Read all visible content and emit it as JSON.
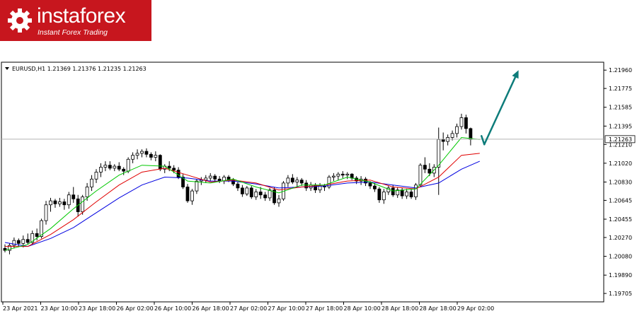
{
  "logo": {
    "brand": "instaforex",
    "tagline": "Instant Forex Trading",
    "icon": "gear-icon",
    "bg_color": "#c7161e"
  },
  "chart_data": {
    "type": "candlestick",
    "symbol_header": "EURUSD,H1  1.21369 1.21376 1.21235 1.21263",
    "current_price_label": "1.21263",
    "current_price": 1.21263,
    "ylim": [
      1.1962,
      1.2204
    ],
    "y_ticks": [
      "1.21960",
      "1.21775",
      "1.21585",
      "1.21395",
      "1.21210",
      "1.21020",
      "1.20830",
      "1.20645",
      "1.20455",
      "1.20270",
      "1.20080",
      "1.19890",
      "1.19705"
    ],
    "x_ticks": [
      "23 Apr 2021",
      "23 Apr 10:00",
      "23 Apr 18:00",
      "26 Apr 02:00",
      "26 Apr 10:00",
      "26 Apr 18:00",
      "27 Apr 02:00",
      "27 Apr 10:00",
      "27 Apr 18:00",
      "28 Apr 10:00",
      "28 Apr 18:00",
      "28 Apr 18:00",
      "29 Apr 02:00"
    ],
    "ohlc": [
      [
        1.2016,
        1.202,
        1.2012,
        1.2014
      ],
      [
        1.2014,
        1.2021,
        1.201,
        1.2019
      ],
      [
        1.2019,
        1.2027,
        1.2016,
        1.2024
      ],
      [
        1.2024,
        1.2026,
        1.2018,
        1.2021
      ],
      [
        1.2021,
        1.2029,
        1.2017,
        1.2025
      ],
      [
        1.2025,
        1.2031,
        1.202,
        1.2022
      ],
      [
        1.2022,
        1.2034,
        1.202,
        1.2031
      ],
      [
        1.2031,
        1.2036,
        1.2024,
        1.2028
      ],
      [
        1.2028,
        1.2046,
        1.2026,
        1.2044
      ],
      [
        1.2044,
        1.2064,
        1.204,
        1.206
      ],
      [
        1.206,
        1.2067,
        1.2053,
        1.2064
      ],
      [
        1.2064,
        1.2066,
        1.2057,
        1.2061
      ],
      [
        1.2061,
        1.2067,
        1.2058,
        1.2063
      ],
      [
        1.2063,
        1.2066,
        1.2055,
        1.206
      ],
      [
        1.206,
        1.2073,
        1.2056,
        1.207
      ],
      [
        1.207,
        1.2078,
        1.2062,
        1.2066
      ],
      [
        1.2066,
        1.207,
        1.2048,
        1.2053
      ],
      [
        1.2053,
        1.207,
        1.205,
        1.2068
      ],
      [
        1.2068,
        1.2082,
        1.2064,
        1.2078
      ],
      [
        1.2078,
        1.209,
        1.2074,
        1.2086
      ],
      [
        1.2086,
        1.2096,
        1.2082,
        1.2093
      ],
      [
        1.2093,
        1.2102,
        1.2088,
        1.2098
      ],
      [
        1.2098,
        1.2104,
        1.2094,
        1.21
      ],
      [
        1.21,
        1.2104,
        1.2095,
        1.2097
      ],
      [
        1.2097,
        1.2101,
        1.2094,
        1.2099
      ],
      [
        1.2099,
        1.2103,
        1.2094,
        1.2096
      ],
      [
        1.2096,
        1.2098,
        1.209,
        1.2094
      ],
      [
        1.2094,
        1.2108,
        1.2092,
        1.2106
      ],
      [
        1.2106,
        1.2113,
        1.2102,
        1.211
      ],
      [
        1.211,
        1.2116,
        1.2106,
        1.2112
      ],
      [
        1.2112,
        1.2116,
        1.2108,
        1.2114
      ],
      [
        1.2114,
        1.2117,
        1.2108,
        1.2111
      ],
      [
        1.2111,
        1.2113,
        1.2105,
        1.2108
      ],
      [
        1.2108,
        1.2114,
        1.2104,
        1.211
      ],
      [
        1.211,
        1.2111,
        1.2094,
        1.2096
      ],
      [
        1.2096,
        1.2101,
        1.2092,
        1.2099
      ],
      [
        1.2099,
        1.2104,
        1.2094,
        1.2097
      ],
      [
        1.2097,
        1.21,
        1.2092,
        1.2095
      ],
      [
        1.2095,
        1.2098,
        1.2086,
        1.2088
      ],
      [
        1.2088,
        1.2091,
        1.2076,
        1.2078
      ],
      [
        1.2078,
        1.2081,
        1.2062,
        1.2064
      ],
      [
        1.2064,
        1.2076,
        1.206,
        1.2074
      ],
      [
        1.2074,
        1.2086,
        1.2071,
        1.2084
      ],
      [
        1.2084,
        1.2088,
        1.208,
        1.2085
      ],
      [
        1.2085,
        1.209,
        1.2082,
        1.2087
      ],
      [
        1.2087,
        1.2092,
        1.2084,
        1.2089
      ],
      [
        1.2089,
        1.2091,
        1.2084,
        1.2086
      ],
      [
        1.2086,
        1.2089,
        1.2082,
        1.2084
      ],
      [
        1.2084,
        1.209,
        1.2081,
        1.2088
      ],
      [
        1.2088,
        1.209,
        1.2083,
        1.2085
      ],
      [
        1.2085,
        1.2087,
        1.2079,
        1.2081
      ],
      [
        1.2081,
        1.2083,
        1.2074,
        1.2077
      ],
      [
        1.2077,
        1.208,
        1.2068,
        1.2071
      ],
      [
        1.2071,
        1.2079,
        1.2069,
        1.2077
      ],
      [
        1.2077,
        1.2079,
        1.2066,
        1.2068
      ],
      [
        1.2068,
        1.2076,
        1.2065,
        1.2073
      ],
      [
        1.2073,
        1.2078,
        1.2066,
        1.207
      ],
      [
        1.207,
        1.2073,
        1.2064,
        1.2067
      ],
      [
        1.2067,
        1.2077,
        1.2064,
        1.2075
      ],
      [
        1.2075,
        1.2078,
        1.206,
        1.2062
      ],
      [
        1.2062,
        1.207,
        1.2058,
        1.2066
      ],
      [
        1.2066,
        1.2084,
        1.2064,
        1.2082
      ],
      [
        1.2082,
        1.209,
        1.2078,
        1.2087
      ],
      [
        1.2087,
        1.2091,
        1.2081,
        1.2083
      ],
      [
        1.2083,
        1.2088,
        1.2078,
        1.2085
      ],
      [
        1.2085,
        1.2087,
        1.2079,
        1.2082
      ],
      [
        1.2082,
        1.2085,
        1.2074,
        1.2077
      ],
      [
        1.2077,
        1.2083,
        1.2074,
        1.208
      ],
      [
        1.208,
        1.2082,
        1.2072,
        1.2075
      ],
      [
        1.2075,
        1.2082,
        1.2072,
        1.2079
      ],
      [
        1.2079,
        1.2081,
        1.2074,
        1.2078
      ],
      [
        1.2078,
        1.209,
        1.2076,
        1.2088
      ],
      [
        1.2088,
        1.2092,
        1.2084,
        1.2089
      ],
      [
        1.2089,
        1.2093,
        1.2085,
        1.2091
      ],
      [
        1.2091,
        1.2094,
        1.2087,
        1.209
      ],
      [
        1.209,
        1.2093,
        1.2086,
        1.2091
      ],
      [
        1.2091,
        1.2092,
        1.2085,
        1.2087
      ],
      [
        1.2087,
        1.2089,
        1.2081,
        1.2084
      ],
      [
        1.2084,
        1.2089,
        1.208,
        1.2086
      ],
      [
        1.2086,
        1.2088,
        1.2079,
        1.2082
      ],
      [
        1.2082,
        1.2084,
        1.2076,
        1.2079
      ],
      [
        1.2079,
        1.2082,
        1.2073,
        1.2076
      ],
      [
        1.2076,
        1.2078,
        1.2062,
        1.2065
      ],
      [
        1.2065,
        1.2076,
        1.2061,
        1.2073
      ],
      [
        1.2073,
        1.2079,
        1.207,
        1.2077
      ],
      [
        1.2077,
        1.208,
        1.2068,
        1.207
      ],
      [
        1.207,
        1.2078,
        1.2067,
        1.2075
      ],
      [
        1.2075,
        1.2077,
        1.2066,
        1.2069
      ],
      [
        1.2069,
        1.2076,
        1.2066,
        1.2073
      ],
      [
        1.2073,
        1.2076,
        1.2066,
        1.2068
      ],
      [
        1.2068,
        1.2082,
        1.2065,
        1.208
      ],
      [
        1.208,
        1.2102,
        1.2078,
        1.21
      ],
      [
        1.21,
        1.2108,
        1.2092,
        1.2096
      ],
      [
        1.2096,
        1.2102,
        1.2089,
        1.2092
      ],
      [
        1.2092,
        1.2101,
        1.2088,
        1.2098
      ],
      [
        1.2098,
        1.2138,
        1.207,
        1.2126
      ],
      [
        1.2126,
        1.2133,
        1.2115,
        1.2124
      ],
      [
        1.2124,
        1.2131,
        1.212,
        1.2128
      ],
      [
        1.2128,
        1.2135,
        1.2125,
        1.2132
      ],
      [
        1.2132,
        1.2142,
        1.2128,
        1.2139
      ],
      [
        1.2139,
        1.2152,
        1.2136,
        1.2148
      ],
      [
        1.2148,
        1.2151,
        1.2132,
        1.2137
      ],
      [
        1.2137,
        1.2138,
        1.212,
        1.2126
      ]
    ],
    "ma_green": [
      [
        0,
        1.2014
      ],
      [
        5,
        1.202
      ],
      [
        10,
        1.2036
      ],
      [
        15,
        1.2056
      ],
      [
        20,
        1.2074
      ],
      [
        25,
        1.209
      ],
      [
        30,
        1.21
      ],
      [
        35,
        1.2099
      ],
      [
        40,
        1.2084
      ],
      [
        45,
        1.2082
      ],
      [
        50,
        1.2086
      ],
      [
        55,
        1.2078
      ],
      [
        60,
        1.2072
      ],
      [
        65,
        1.208
      ],
      [
        70,
        1.208
      ],
      [
        75,
        1.2088
      ],
      [
        80,
        1.2083
      ],
      [
        85,
        1.2074
      ],
      [
        90,
        1.2076
      ],
      [
        95,
        1.21
      ],
      [
        100,
        1.2128
      ],
      [
        104,
        1.2126
      ]
    ],
    "ma_red": [
      [
        0,
        1.2018
      ],
      [
        5,
        1.2018
      ],
      [
        10,
        1.203
      ],
      [
        15,
        1.2045
      ],
      [
        20,
        1.2063
      ],
      [
        25,
        1.208
      ],
      [
        30,
        1.2093
      ],
      [
        35,
        1.2097
      ],
      [
        40,
        1.209
      ],
      [
        45,
        1.2083
      ],
      [
        50,
        1.2085
      ],
      [
        55,
        1.2082
      ],
      [
        60,
        1.2075
      ],
      [
        65,
        1.2078
      ],
      [
        70,
        1.208
      ],
      [
        75,
        1.2084
      ],
      [
        80,
        1.2085
      ],
      [
        85,
        1.2078
      ],
      [
        90,
        1.2076
      ],
      [
        95,
        1.2088
      ],
      [
        100,
        1.211
      ],
      [
        104,
        1.2112
      ]
    ],
    "ma_blue": [
      [
        0,
        1.2022
      ],
      [
        5,
        1.2018
      ],
      [
        10,
        1.2026
      ],
      [
        15,
        1.2037
      ],
      [
        20,
        1.2052
      ],
      [
        25,
        1.2067
      ],
      [
        30,
        1.208
      ],
      [
        35,
        1.2088
      ],
      [
        40,
        1.2087
      ],
      [
        45,
        1.2084
      ],
      [
        50,
        1.2084
      ],
      [
        55,
        1.2081
      ],
      [
        60,
        1.2077
      ],
      [
        65,
        1.2078
      ],
      [
        70,
        1.2079
      ],
      [
        75,
        1.2082
      ],
      [
        80,
        1.2083
      ],
      [
        85,
        1.208
      ],
      [
        90,
        1.2077
      ],
      [
        95,
        1.2082
      ],
      [
        100,
        1.2096
      ],
      [
        104,
        1.2104
      ]
    ],
    "arrow": {
      "from": [
        105.0,
        1.2121
      ],
      "to": [
        112.5,
        1.2196
      ],
      "color": "#0d7c7a"
    },
    "colors": {
      "ma_green": "#00c800",
      "ma_red": "#e00000",
      "ma_blue": "#0000e0",
      "candle": "#000000"
    }
  }
}
